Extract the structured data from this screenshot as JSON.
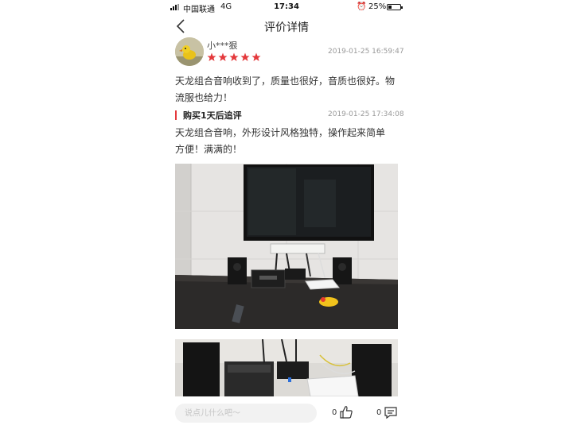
{
  "status_bar": {
    "carrier": "中国联通",
    "network": "4G",
    "time": "17:34",
    "battery_percent": "25%",
    "battery_level": 0.25,
    "icons": [
      "signal-icon",
      "alarm-icon",
      "battery-icon"
    ]
  },
  "nav": {
    "title": "评价详情",
    "back_icon": "chevron-left-icon"
  },
  "review": {
    "username": "小***狠",
    "rating": 5,
    "date": "2019-01-25 16:59:47",
    "text": "天龙组合音响收到了，质量也很好，音质也很好。物流服也给力！",
    "star_color": "#e4393c"
  },
  "followup": {
    "label": "购买1天后追评",
    "date": "2019-01-25 17:34:08",
    "text": "天龙组合音响，外形设计风格独特，操作起来简单方便！满满的！",
    "accent_color": "#e4393c"
  },
  "footer": {
    "comment_placeholder": "说点儿什么吧～",
    "like_count": "0",
    "comment_count": "0",
    "icons": [
      "thumbs-up-icon",
      "comment-icon"
    ]
  }
}
